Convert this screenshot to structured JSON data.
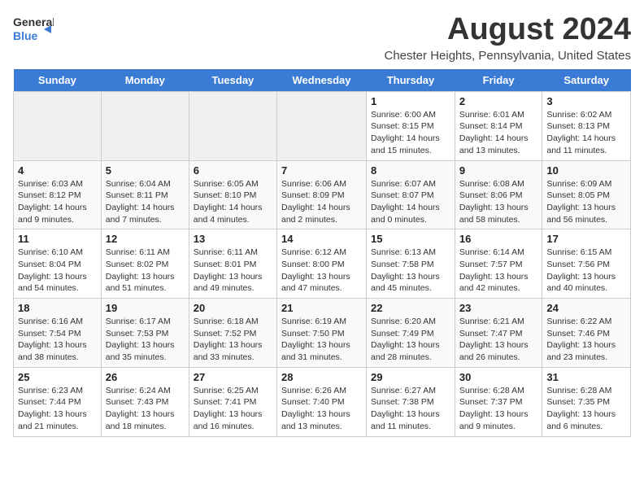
{
  "logo": {
    "general": "General",
    "blue": "Blue"
  },
  "title": "August 2024",
  "subtitle": "Chester Heights, Pennsylvania, United States",
  "headers": [
    "Sunday",
    "Monday",
    "Tuesday",
    "Wednesday",
    "Thursday",
    "Friday",
    "Saturday"
  ],
  "weeks": [
    [
      {
        "day": "",
        "content": ""
      },
      {
        "day": "",
        "content": ""
      },
      {
        "day": "",
        "content": ""
      },
      {
        "day": "",
        "content": ""
      },
      {
        "day": "1",
        "content": "Sunrise: 6:00 AM\nSunset: 8:15 PM\nDaylight: 14 hours\nand 15 minutes."
      },
      {
        "day": "2",
        "content": "Sunrise: 6:01 AM\nSunset: 8:14 PM\nDaylight: 14 hours\nand 13 minutes."
      },
      {
        "day": "3",
        "content": "Sunrise: 6:02 AM\nSunset: 8:13 PM\nDaylight: 14 hours\nand 11 minutes."
      }
    ],
    [
      {
        "day": "4",
        "content": "Sunrise: 6:03 AM\nSunset: 8:12 PM\nDaylight: 14 hours\nand 9 minutes."
      },
      {
        "day": "5",
        "content": "Sunrise: 6:04 AM\nSunset: 8:11 PM\nDaylight: 14 hours\nand 7 minutes."
      },
      {
        "day": "6",
        "content": "Sunrise: 6:05 AM\nSunset: 8:10 PM\nDaylight: 14 hours\nand 4 minutes."
      },
      {
        "day": "7",
        "content": "Sunrise: 6:06 AM\nSunset: 8:09 PM\nDaylight: 14 hours\nand 2 minutes."
      },
      {
        "day": "8",
        "content": "Sunrise: 6:07 AM\nSunset: 8:07 PM\nDaylight: 14 hours\nand 0 minutes."
      },
      {
        "day": "9",
        "content": "Sunrise: 6:08 AM\nSunset: 8:06 PM\nDaylight: 13 hours\nand 58 minutes."
      },
      {
        "day": "10",
        "content": "Sunrise: 6:09 AM\nSunset: 8:05 PM\nDaylight: 13 hours\nand 56 minutes."
      }
    ],
    [
      {
        "day": "11",
        "content": "Sunrise: 6:10 AM\nSunset: 8:04 PM\nDaylight: 13 hours\nand 54 minutes."
      },
      {
        "day": "12",
        "content": "Sunrise: 6:11 AM\nSunset: 8:02 PM\nDaylight: 13 hours\nand 51 minutes."
      },
      {
        "day": "13",
        "content": "Sunrise: 6:11 AM\nSunset: 8:01 PM\nDaylight: 13 hours\nand 49 minutes."
      },
      {
        "day": "14",
        "content": "Sunrise: 6:12 AM\nSunset: 8:00 PM\nDaylight: 13 hours\nand 47 minutes."
      },
      {
        "day": "15",
        "content": "Sunrise: 6:13 AM\nSunset: 7:58 PM\nDaylight: 13 hours\nand 45 minutes."
      },
      {
        "day": "16",
        "content": "Sunrise: 6:14 AM\nSunset: 7:57 PM\nDaylight: 13 hours\nand 42 minutes."
      },
      {
        "day": "17",
        "content": "Sunrise: 6:15 AM\nSunset: 7:56 PM\nDaylight: 13 hours\nand 40 minutes."
      }
    ],
    [
      {
        "day": "18",
        "content": "Sunrise: 6:16 AM\nSunset: 7:54 PM\nDaylight: 13 hours\nand 38 minutes."
      },
      {
        "day": "19",
        "content": "Sunrise: 6:17 AM\nSunset: 7:53 PM\nDaylight: 13 hours\nand 35 minutes."
      },
      {
        "day": "20",
        "content": "Sunrise: 6:18 AM\nSunset: 7:52 PM\nDaylight: 13 hours\nand 33 minutes."
      },
      {
        "day": "21",
        "content": "Sunrise: 6:19 AM\nSunset: 7:50 PM\nDaylight: 13 hours\nand 31 minutes."
      },
      {
        "day": "22",
        "content": "Sunrise: 6:20 AM\nSunset: 7:49 PM\nDaylight: 13 hours\nand 28 minutes."
      },
      {
        "day": "23",
        "content": "Sunrise: 6:21 AM\nSunset: 7:47 PM\nDaylight: 13 hours\nand 26 minutes."
      },
      {
        "day": "24",
        "content": "Sunrise: 6:22 AM\nSunset: 7:46 PM\nDaylight: 13 hours\nand 23 minutes."
      }
    ],
    [
      {
        "day": "25",
        "content": "Sunrise: 6:23 AM\nSunset: 7:44 PM\nDaylight: 13 hours\nand 21 minutes."
      },
      {
        "day": "26",
        "content": "Sunrise: 6:24 AM\nSunset: 7:43 PM\nDaylight: 13 hours\nand 18 minutes."
      },
      {
        "day": "27",
        "content": "Sunrise: 6:25 AM\nSunset: 7:41 PM\nDaylight: 13 hours\nand 16 minutes."
      },
      {
        "day": "28",
        "content": "Sunrise: 6:26 AM\nSunset: 7:40 PM\nDaylight: 13 hours\nand 13 minutes."
      },
      {
        "day": "29",
        "content": "Sunrise: 6:27 AM\nSunset: 7:38 PM\nDaylight: 13 hours\nand 11 minutes."
      },
      {
        "day": "30",
        "content": "Sunrise: 6:28 AM\nSunset: 7:37 PM\nDaylight: 13 hours\nand 9 minutes."
      },
      {
        "day": "31",
        "content": "Sunrise: 6:28 AM\nSunset: 7:35 PM\nDaylight: 13 hours\nand 6 minutes."
      }
    ]
  ]
}
